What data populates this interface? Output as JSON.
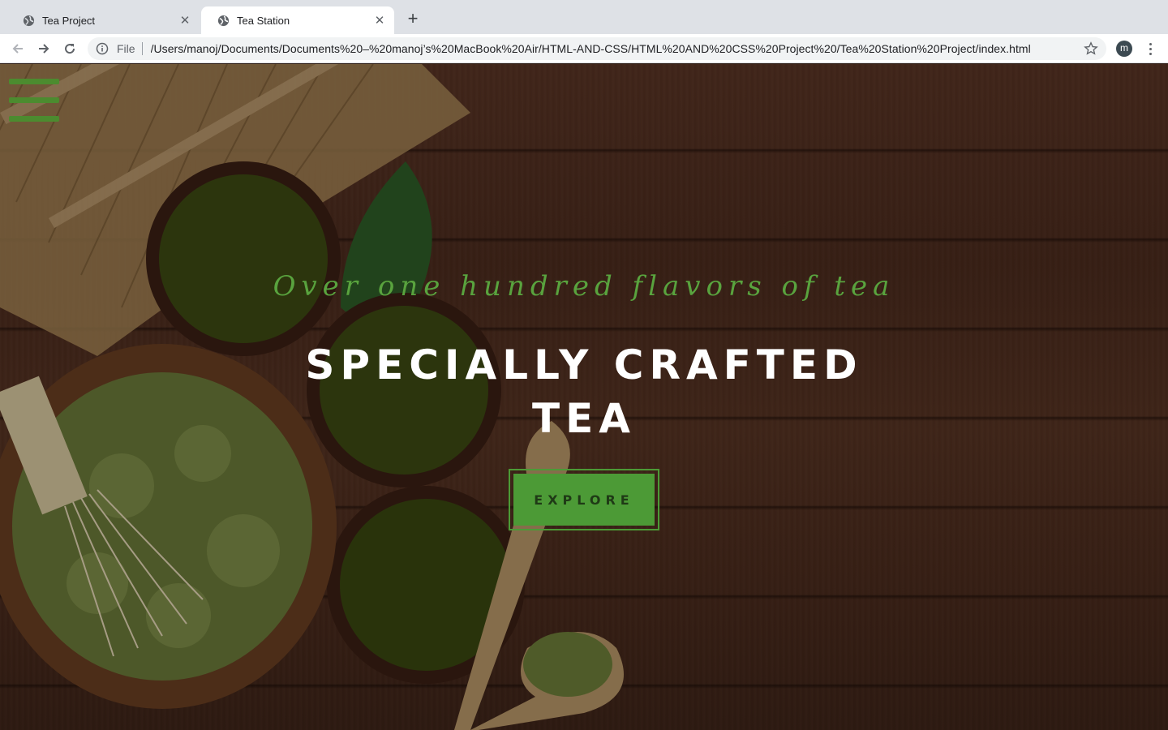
{
  "browser": {
    "tabs": [
      {
        "title": "Tea Project",
        "active": false
      },
      {
        "title": "Tea Station",
        "active": true
      }
    ],
    "address": {
      "scheme": "File",
      "url": "/Users/manoj/Documents/Documents%20–%20manoj’s%20MacBook%20Air/HTML-AND-CSS/HTML%20AND%20CSS%20Project%20/Tea%20Station%20Project/index.html"
    },
    "profile_initial": "m"
  },
  "hero": {
    "subtitle": "Over one hundred flavors of tea",
    "headline": "SPECIALLY CRAFTED TEA",
    "cta_label": "EXPLORE"
  },
  "colors": {
    "accent_green": "#4c9a36",
    "subtitle_green": "#59a33e",
    "headline_white": "#ffffff"
  },
  "icons": [
    "globe-icon",
    "close-icon",
    "plus-icon",
    "back-arrow-icon",
    "forward-arrow-icon",
    "reload-icon",
    "info-icon",
    "star-icon",
    "kebab-menu-icon",
    "hamburger-menu-icon"
  ]
}
